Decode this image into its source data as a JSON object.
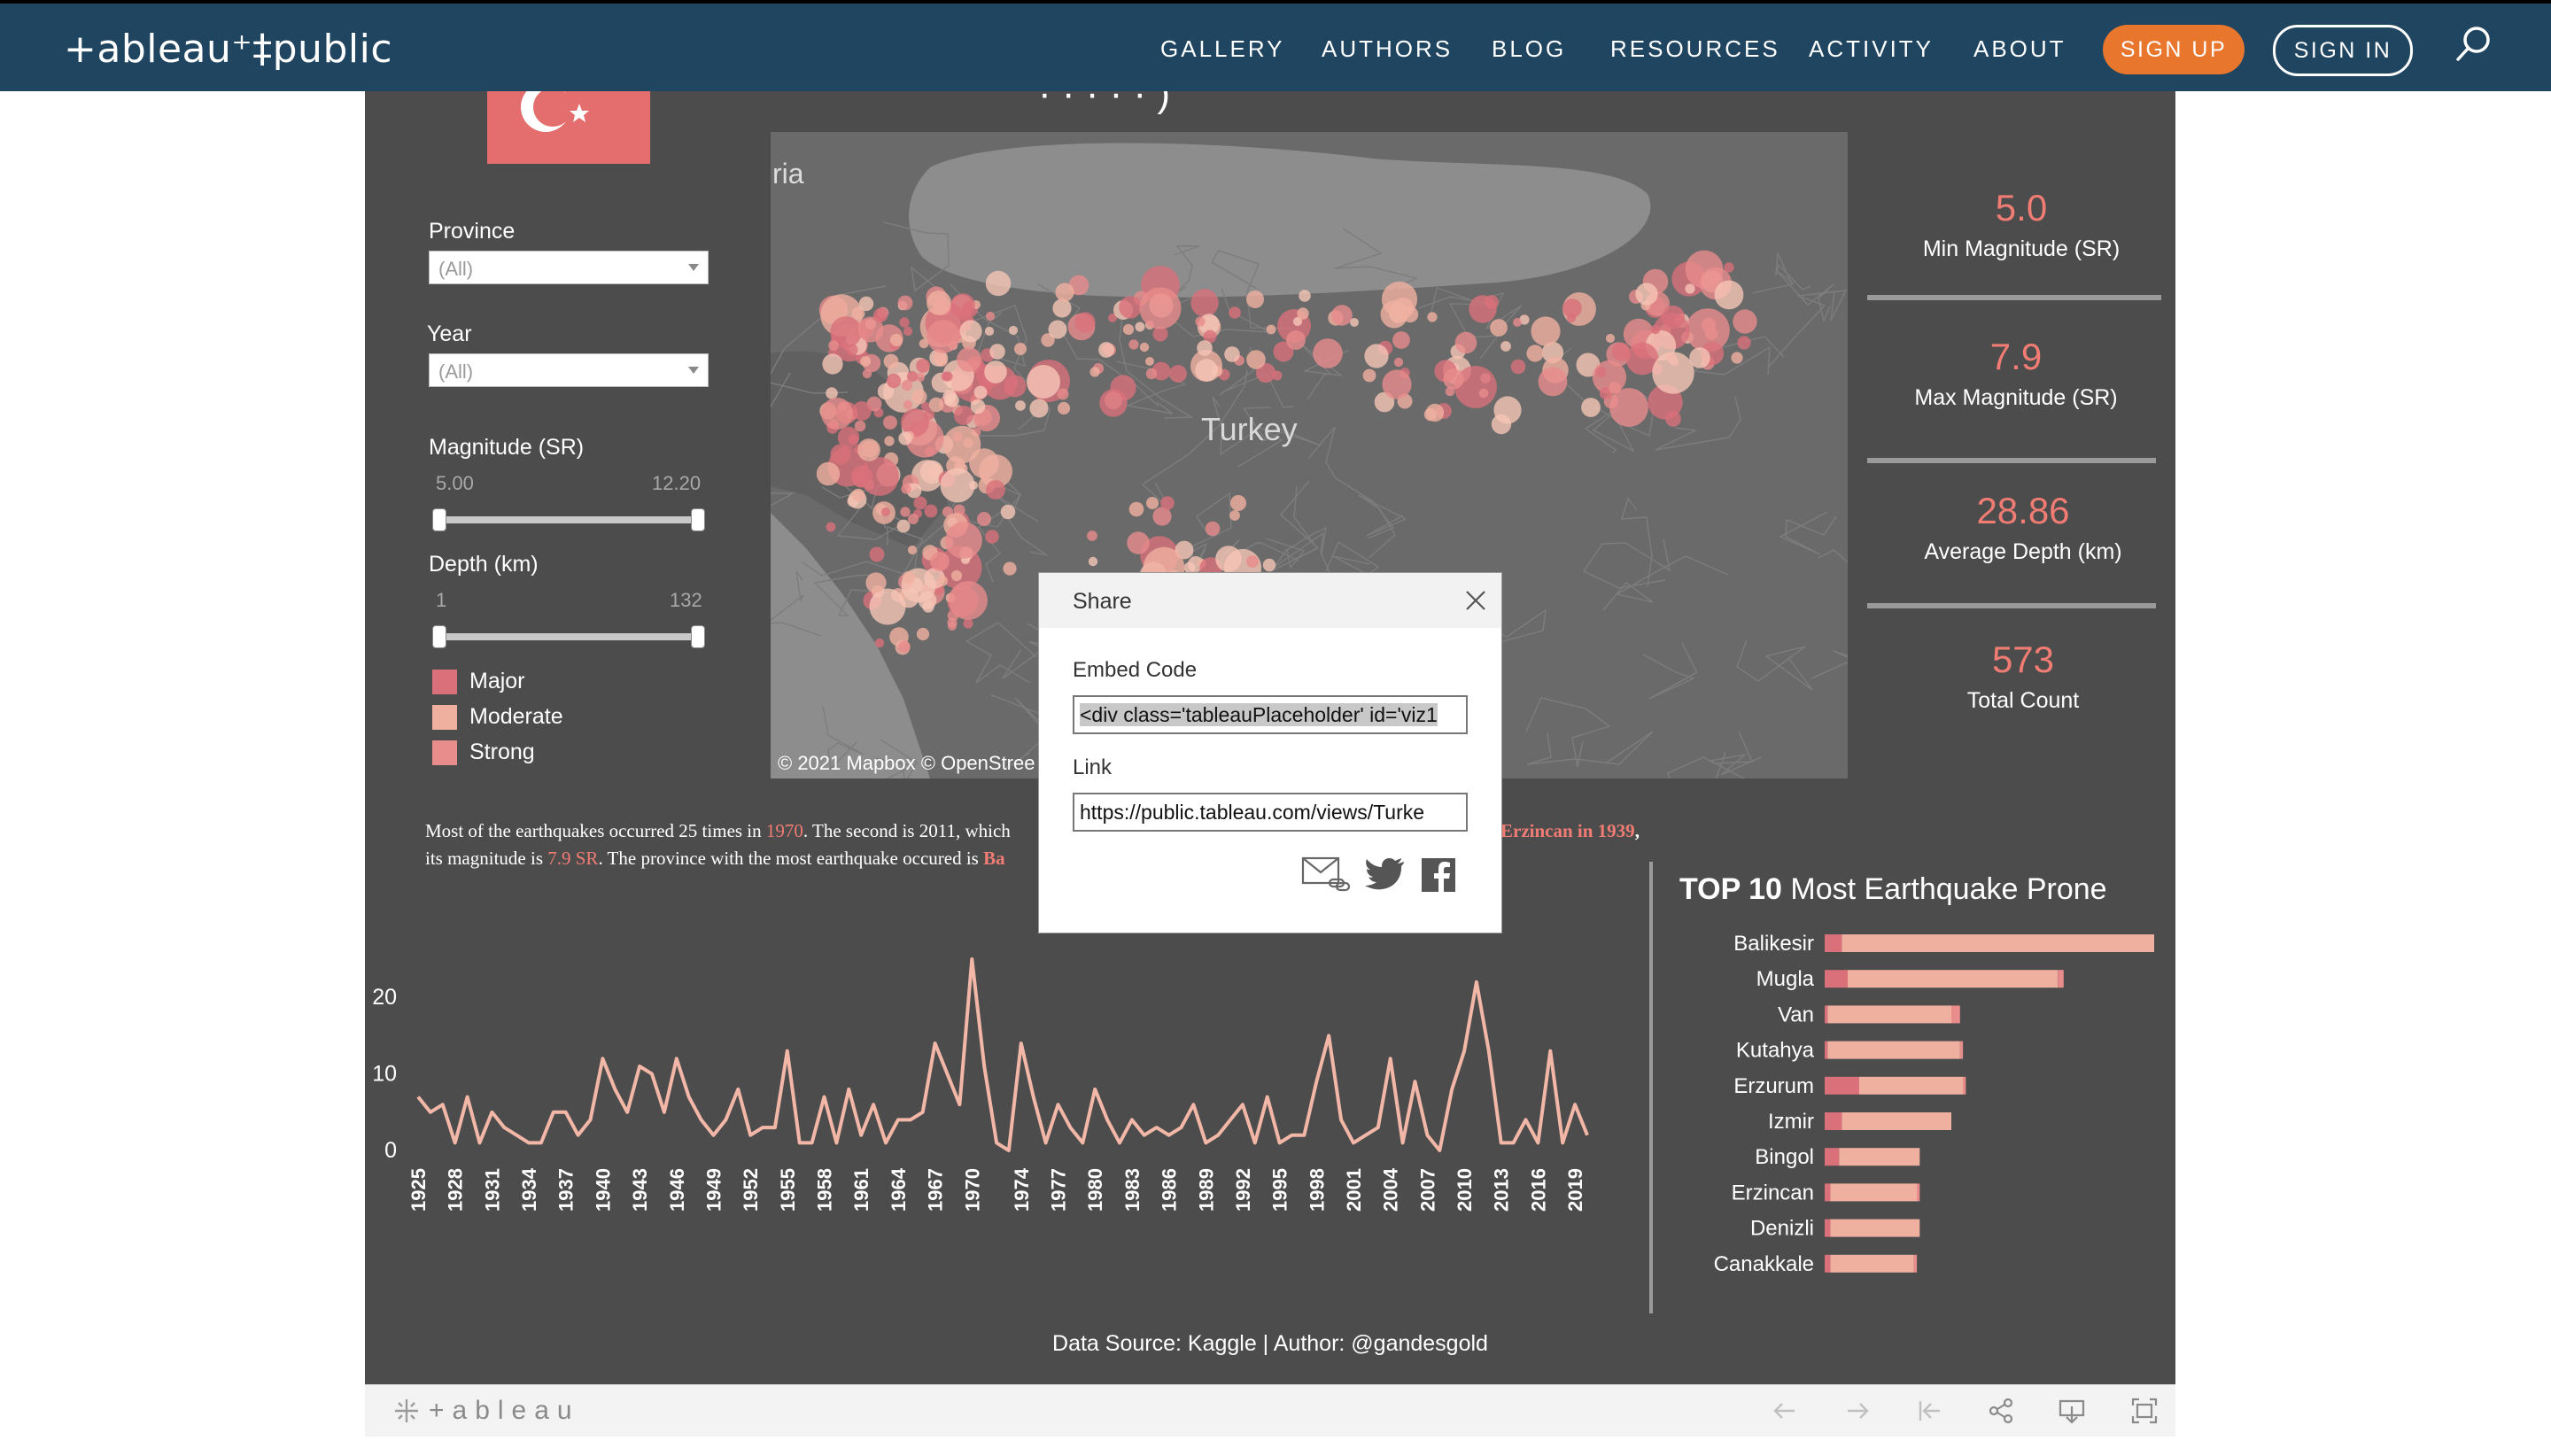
{
  "nav": {
    "brand": "+ableau⁺‡public",
    "links": [
      "GALLERY",
      "AUTHORS",
      "BLOG",
      "RESOURCES",
      "ACTIVITY",
      "ABOUT"
    ],
    "signup": "SIGN UP",
    "signin": "SIGN IN"
  },
  "dashboard": {
    "title_fragment": "·  ·  ·  ·  · )",
    "filters": {
      "province_label": "Province",
      "province_value": "(All)",
      "year_label": "Year",
      "year_value": "(All)",
      "magnitude_label": "Magnitude (SR)",
      "magnitude_min": "5.00",
      "magnitude_max": "12.20",
      "depth_label": "Depth (km)",
      "depth_min": "1",
      "depth_max": "132"
    },
    "legend": [
      {
        "label": "Major",
        "color": "#d9707a"
      },
      {
        "label": "Moderate",
        "color": "#f0b0a0"
      },
      {
        "label": "Strong",
        "color": "#e98c8c"
      }
    ],
    "map": {
      "label_country": "Turkey",
      "label_partial": "ria",
      "attribution": "© 2021 Mapbox  © OpenStree"
    },
    "kpis": [
      {
        "value": "5.0",
        "label": "Min Magnitude (SR)"
      },
      {
        "value": "7.9",
        "label": "Max Magnitude (SR)"
      },
      {
        "value": "28.86",
        "label": "Average Depth (km)"
      },
      {
        "value": "573",
        "label": "Total Count"
      }
    ],
    "caption": {
      "l1a": "Most of the earthquakes occurred 25 times in ",
      "l1b": "1970",
      "l1c": ". The second is 2011, which",
      "l1d": "Erzincan in 1939",
      "l1e": ",",
      "l2a": "its magnitude is ",
      "l2b": "7.9 SR",
      "l2c": ". The province with the most earthquake occured is ",
      "l2d": "Ba"
    },
    "bar_title_bold": "TOP 10",
    "bar_title_rest": " Most Earthquake Prone",
    "footer": "Data Source: Kaggle | Author: @gandesgold"
  },
  "toolbar": {
    "logo": "+ableau"
  },
  "share": {
    "title": "Share",
    "embed_label": "Embed Code",
    "embed_value": "<div class='tableauPlaceholder' id='viz1",
    "link_label": "Link",
    "link_value": "https://public.tableau.com/views/Turke"
  },
  "chart_data": [
    {
      "type": "line",
      "title": "",
      "xlabel": "",
      "ylabel": "",
      "x": [
        1925,
        1926,
        1927,
        1928,
        1929,
        1930,
        1931,
        1932,
        1933,
        1934,
        1935,
        1936,
        1937,
        1938,
        1939,
        1940,
        1941,
        1942,
        1943,
        1944,
        1945,
        1946,
        1947,
        1948,
        1949,
        1950,
        1951,
        1952,
        1953,
        1954,
        1955,
        1956,
        1957,
        1958,
        1959,
        1960,
        1961,
        1962,
        1963,
        1964,
        1965,
        1966,
        1967,
        1968,
        1969,
        1970,
        1971,
        1972,
        1973,
        1974,
        1975,
        1976,
        1977,
        1978,
        1979,
        1980,
        1981,
        1982,
        1983,
        1984,
        1985,
        1986,
        1987,
        1988,
        1989,
        1990,
        1991,
        1992,
        1993,
        1994,
        1995,
        1996,
        1997,
        1998,
        1999,
        2000,
        2001,
        2002,
        2003,
        2004,
        2005,
        2006,
        2007,
        2008,
        2009,
        2010,
        2011,
        2012,
        2013,
        2014,
        2015,
        2016,
        2017,
        2018,
        2019,
        2020
      ],
      "x_tick_labels": [
        "1925",
        "1928",
        "1931",
        "1934",
        "1937",
        "1940",
        "1943",
        "1946",
        "1949",
        "1952",
        "1955",
        "1958",
        "1961",
        "1964",
        "1967",
        "1970",
        "1974",
        "1977",
        "1980",
        "1983",
        "1986",
        "1989",
        "1992",
        "1995",
        "1998",
        "2001",
        "2004",
        "2007",
        "2010",
        "2013",
        "2016",
        "2019"
      ],
      "values": [
        7,
        5,
        6,
        1,
        7,
        1,
        5,
        3,
        2,
        1,
        1,
        5,
        5,
        2,
        4,
        12,
        8,
        5,
        11,
        10,
        5,
        12,
        7,
        4,
        2,
        4,
        8,
        2,
        3,
        3,
        13,
        1,
        1,
        7,
        1,
        8,
        2,
        6,
        1,
        4,
        4,
        5,
        14,
        10,
        6,
        25,
        11,
        1,
        0,
        14,
        7,
        1,
        6,
        3,
        1,
        8,
        4,
        1,
        4,
        2,
        3,
        2,
        3,
        6,
        1,
        2,
        4,
        6,
        1,
        7,
        1,
        2,
        2,
        9,
        15,
        4,
        1,
        2,
        3,
        12,
        1,
        9,
        2,
        0,
        8,
        13,
        22,
        13,
        1,
        1,
        4,
        1,
        13,
        1,
        6,
        2
      ],
      "y_ticks": [
        0,
        10,
        20
      ],
      "ylim": [
        0,
        25
      ],
      "color": "#f2b7a7"
    },
    {
      "type": "bar",
      "title": "TOP 10 Most Earthquake Prone",
      "categories": [
        "Balikesir",
        "Mugla",
        "Van",
        "Kutahya",
        "Erzurum",
        "Izmir",
        "Bingol",
        "Erzincan",
        "Denizli",
        "Canakkale"
      ],
      "series": [
        {
          "name": "Major",
          "values": [
            6,
            8,
            1,
            1,
            12,
            6,
            5,
            2,
            2,
            2
          ],
          "color": "#d9707a"
        },
        {
          "name": "Moderate",
          "values": [
            112,
            73,
            43,
            46,
            36,
            38,
            28,
            30,
            31,
            29
          ],
          "color": "#f0b0a0"
        },
        {
          "name": "Strong",
          "values": [
            0,
            2,
            3,
            1,
            1,
            0,
            0,
            1,
            0,
            1
          ],
          "color": "#e98c8c"
        }
      ],
      "xlim": [
        0,
        120
      ]
    }
  ]
}
